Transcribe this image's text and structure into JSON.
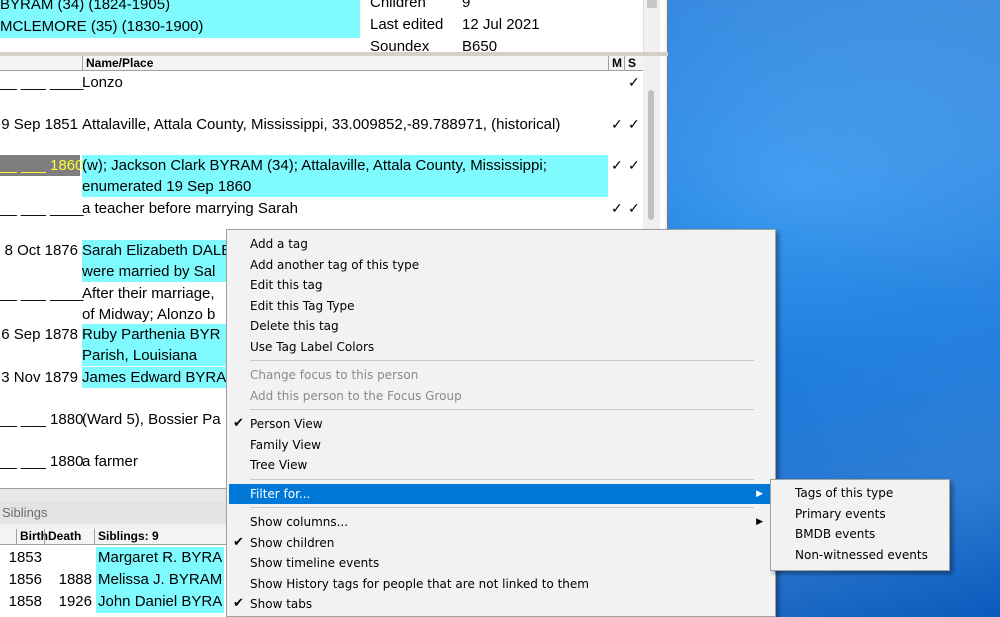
{
  "top": {
    "parents": [
      {
        "text": "BYRAM (34)  (1824-1905)"
      },
      {
        "text": "MCLEMORE (35)  (1830-1900)"
      }
    ],
    "info": [
      {
        "label": "Children",
        "value": "9"
      },
      {
        "label": "Last edited",
        "value": "12 Jul 2021"
      },
      {
        "label": "Soundex",
        "value": "B650"
      }
    ]
  },
  "events": {
    "headers": {
      "name_place": "Name/Place",
      "m": "M",
      "s": "S"
    },
    "rows": [
      {
        "date": "__ ___ ____",
        "text": "Lonzo",
        "m": "",
        "s": "✓",
        "hl": false,
        "sel": false
      },
      {
        "date": "9 Sep 1851",
        "text": "Attalaville, Attala County, Mississippi, 33.009852,-89.788971, (historical)",
        "m": "✓",
        "s": "✓",
        "hl": false,
        "sel": false
      },
      {
        "date": "__ ___ 1860",
        "text": "(w); Jackson Clark BYRAM (34); Attalaville, Attala County, Mississippi;\nenumerated 19 Sep 1860",
        "m": "✓",
        "s": "✓",
        "hl": true,
        "sel": true
      },
      {
        "date": "__ ___ ____",
        "text": "a teacher before marrying Sarah",
        "m": "✓",
        "s": "✓",
        "hl": false,
        "sel": false
      },
      {
        "date": "8 Oct 1876",
        "text": "Sarah Elizabeth DALE\nwere married by Sal",
        "m": "",
        "s": "",
        "hl": true,
        "sel": false
      },
      {
        "date": "__ ___ ____",
        "text": "After their marriage,\nof Midway; Alonzo b",
        "m": "",
        "s": "",
        "hl": false,
        "sel": false
      },
      {
        "date": "6 Sep 1878",
        "text": "Ruby Parthenia BYR\nParish, Louisiana",
        "m": "",
        "s": "",
        "hl": true,
        "sel": false
      },
      {
        "date": "3 Nov 1879",
        "text": "James Edward BYRA",
        "m": "",
        "s": "",
        "hl": true,
        "sel": false
      },
      {
        "date": "__ ___ 1880",
        "text": "(Ward 5), Bossier Pa",
        "m": "",
        "s": "",
        "hl": false,
        "sel": false
      },
      {
        "date": "__ ___ 1880",
        "text": "a farmer",
        "m": "",
        "s": "",
        "hl": false,
        "sel": false
      }
    ]
  },
  "siblings": {
    "title": "Siblings",
    "headers": {
      "birth": "Birth",
      "death": "Death",
      "name": "Siblings: 9"
    },
    "rows": [
      {
        "birth": "1853",
        "death": "",
        "name": "Margaret R. BYRA"
      },
      {
        "birth": "1856",
        "death": "1888",
        "name": "Melissa J. BYRAM"
      },
      {
        "birth": "1858",
        "death": "1926",
        "name": "John Daniel BYRA"
      }
    ]
  },
  "context_menu": {
    "items": [
      {
        "label": "Add a tag",
        "checked": false,
        "disabled": false,
        "submenu": false,
        "active": false
      },
      {
        "label": "Add another tag of this type",
        "checked": false,
        "disabled": false,
        "submenu": false,
        "active": false
      },
      {
        "label": "Edit this tag",
        "checked": false,
        "disabled": false,
        "submenu": false,
        "active": false
      },
      {
        "label": "Edit this Tag Type",
        "checked": false,
        "disabled": false,
        "submenu": false,
        "active": false
      },
      {
        "label": "Delete this tag",
        "checked": false,
        "disabled": false,
        "submenu": false,
        "active": false
      },
      {
        "label": "Use Tag Label Colors",
        "checked": false,
        "disabled": false,
        "submenu": false,
        "active": false
      },
      {
        "separator": true
      },
      {
        "label": "Change focus to this person",
        "checked": false,
        "disabled": true,
        "submenu": false,
        "active": false
      },
      {
        "label": "Add this person to the Focus Group",
        "checked": false,
        "disabled": true,
        "submenu": false,
        "active": false
      },
      {
        "separator": true
      },
      {
        "label": "Person View",
        "checked": true,
        "disabled": false,
        "submenu": false,
        "active": false
      },
      {
        "label": "Family View",
        "checked": false,
        "disabled": false,
        "submenu": false,
        "active": false
      },
      {
        "label": "Tree View",
        "checked": false,
        "disabled": false,
        "submenu": false,
        "active": false
      },
      {
        "separator": true
      },
      {
        "label": "Filter for...",
        "checked": false,
        "disabled": false,
        "submenu": true,
        "active": true
      },
      {
        "separator": true
      },
      {
        "label": "Show columns...",
        "checked": false,
        "disabled": false,
        "submenu": true,
        "active": false
      },
      {
        "label": "Show children",
        "checked": true,
        "disabled": false,
        "submenu": false,
        "active": false
      },
      {
        "label": "Show timeline events",
        "checked": false,
        "disabled": false,
        "submenu": false,
        "active": false
      },
      {
        "label": "Show History tags for people that are not linked to them",
        "checked": false,
        "disabled": false,
        "submenu": false,
        "active": false
      },
      {
        "label": "Show tabs",
        "checked": true,
        "disabled": false,
        "submenu": false,
        "active": false
      }
    ],
    "check_glyph": "✔",
    "arrow_glyph": "▶"
  },
  "submenu": {
    "items": [
      {
        "label": "Tags of this type"
      },
      {
        "label": "Primary events"
      },
      {
        "label": "BMDB events"
      },
      {
        "label": "Non-witnessed events"
      }
    ]
  }
}
